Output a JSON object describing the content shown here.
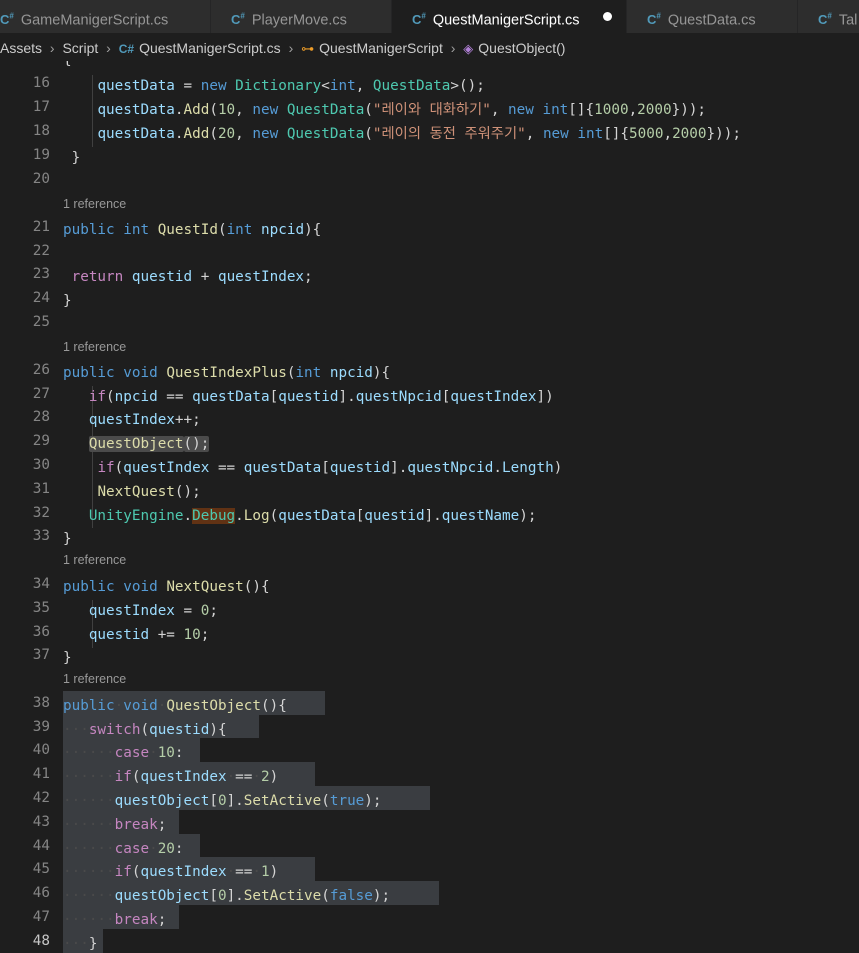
{
  "tabs": [
    {
      "label": "GameManigerScript.cs",
      "icon": "csharp-icon",
      "active": false
    },
    {
      "label": "PlayerMove.cs",
      "icon": "csharp-icon",
      "active": false
    },
    {
      "label": "QuestManigerScript.cs",
      "icon": "csharp-icon",
      "active": true,
      "modified": true
    },
    {
      "label": "QuestData.cs",
      "icon": "csharp-icon",
      "active": false
    },
    {
      "label": "Tal",
      "icon": "csharp-icon",
      "active": false
    }
  ],
  "breadcrumb": {
    "items": [
      "Assets",
      "Script",
      "QuestManigerScript.cs",
      "QuestManigerScript",
      "QuestObject()"
    ]
  },
  "codelens": "1 reference",
  "lines": [
    "19",
    "16",
    "17",
    "18",
    "19",
    "20",
    "21",
    "22",
    "23",
    "24",
    "25",
    "26",
    "27",
    "28",
    "29",
    "30",
    "31",
    "32",
    "33",
    "34",
    "35",
    "36",
    "37",
    "38",
    "39",
    "40",
    "41",
    "42",
    "43",
    "44",
    "45",
    "46",
    "47",
    "48"
  ],
  "strings": {
    "q1": "\"레이와 대화하기\"",
    "q2": "\"레이의 동전 주워주기\""
  },
  "colors": {
    "background": "#1e1e1e",
    "keyword": "#569cd6",
    "type": "#4ec9b0",
    "function": "#dcdcaa",
    "variable": "#9cdcfe",
    "string": "#ce9178",
    "number": "#b5cea8",
    "control": "#c586c0"
  }
}
